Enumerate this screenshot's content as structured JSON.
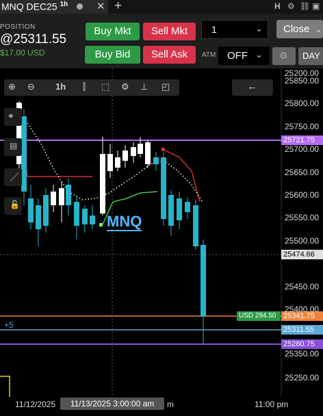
{
  "tab": {
    "title": "MNQ DEC25",
    "interval": "1h"
  },
  "position": {
    "label": "POSITION",
    "value": "@25311.55",
    "pnl": "$17.00 USD"
  },
  "buttons": {
    "buy_mkt": "Buy Mkt",
    "sell_mkt": "Sell Mkt",
    "buy_bid": "Buy Bid",
    "sell_ask": "Sell Ask",
    "close": "Close",
    "day": "DAY"
  },
  "quantity": "1",
  "atm": {
    "label": "ATM",
    "value": "OFF"
  },
  "chart": {
    "interval_button": "1h",
    "watermark": "MNQ",
    "crosshair_position_label": "+5",
    "price_axis": [
      "25850.00",
      "25800.00",
      "25750.00",
      "25700.00",
      "25650.00",
      "25600.00",
      "25550.00",
      "25500.00",
      "25450.00",
      "25400.00",
      "25350.00",
      "25250.00",
      "25200.00"
    ],
    "tags": {
      "purple_upper": "25721.75",
      "crosshair": "25474.66",
      "pnl_usd": "USD 294.50",
      "orange": "25341.75",
      "blue": "25311.55",
      "purple_lower": "25280.75"
    },
    "x_axis": {
      "left": "11/12/2025",
      "tooltip": "11/13/2025 3:00:00 am",
      "mid_suffix": "m",
      "right": "11:00 pm"
    },
    "colors": {
      "up": "#ffffff",
      "down": "#26b5c9",
      "purple": "#b36cf0",
      "orange": "#f0843c",
      "blue": "#5aa8d8",
      "green_tag": "#2e9a46"
    }
  }
}
